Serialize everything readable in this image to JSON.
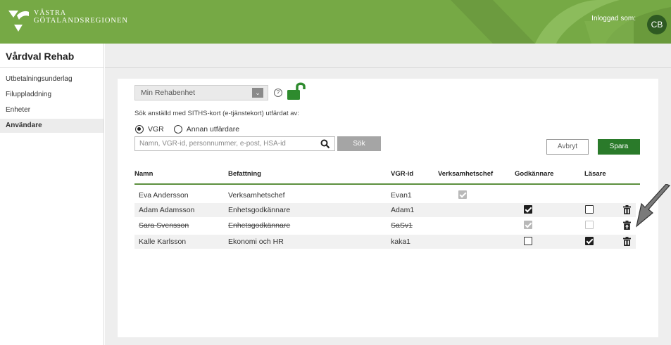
{
  "header": {
    "logo_line1": "VÄSTRA",
    "logo_line2": "GÖTALANDSREGIONEN",
    "logged_in_label": "Inloggad som:",
    "avatar_initials": "CB",
    "brand_color": "#76a945"
  },
  "sidebar": {
    "title": "Vårdval Rehab",
    "items": [
      {
        "label": "Utbetalningsunderlag",
        "active": false
      },
      {
        "label": "Filuppladdning",
        "active": false
      },
      {
        "label": "Enheter",
        "active": false
      },
      {
        "label": "Användare",
        "active": true
      }
    ]
  },
  "form": {
    "unit_select_value": "Min Rehabenhet",
    "help_symbol": "?",
    "siths_label": "Sök anställd med SITHS-kort (e-tjänstekort) utfärdat av:",
    "radio_vgr_label": "VGR",
    "radio_other_label": "Annan utfärdare",
    "radio_selected": "VGR",
    "search_placeholder": "Namn, VGR-id, personnummer, e-post, HSA-id",
    "search_button": "Sök",
    "cancel_button": "Avbryt",
    "save_button": "Spara"
  },
  "table": {
    "headers": {
      "name": "Namn",
      "title": "Befattning",
      "vgr_id": "VGR-id",
      "business_manager": "Verksamhetschef",
      "approver": "Godkännare",
      "reader": "Läsare"
    },
    "rows": [
      {
        "name": "Eva Andersson",
        "title": "Verksamhetschef",
        "vgr_id": "Evan1",
        "business_manager": "checked-disabled",
        "approver": "none",
        "reader": "none",
        "trash": false,
        "struck": false
      },
      {
        "name": "Adam Adamsson",
        "title": "Enhetsgodkännare",
        "vgr_id": "Adam1",
        "business_manager": "none",
        "approver": "checked",
        "reader": "unchecked",
        "trash": true,
        "struck": false
      },
      {
        "name": "Sara Svensson",
        "title": "Enhetsgodkännare",
        "vgr_id": "SaSv1",
        "business_manager": "none",
        "approver": "checked-disabled",
        "reader": "unchecked-disabled",
        "trash": true,
        "struck": true
      },
      {
        "name": "Kalle Karlsson",
        "title": "Ekonomi och HR",
        "vgr_id": "kaka1",
        "business_manager": "none",
        "approver": "unchecked",
        "reader": "checked",
        "trash": true,
        "struck": false
      }
    ]
  },
  "icons": {
    "help": "help-icon",
    "lock": "unlocked-padlock-icon",
    "search": "search-icon",
    "trash": "trash-icon",
    "pointer": "pointer-arrow-icon",
    "dropdown": "chevron-down-icon"
  }
}
